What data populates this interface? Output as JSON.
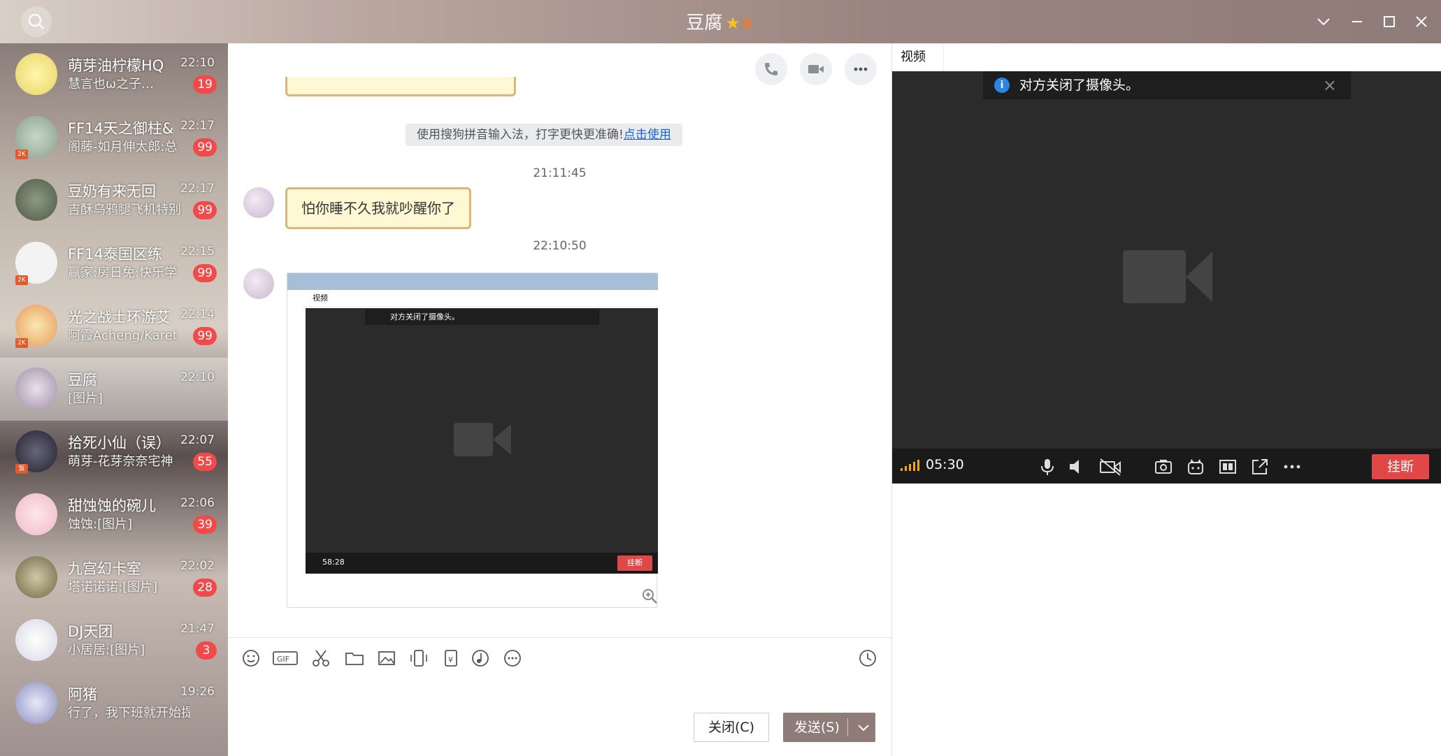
{
  "window": {
    "title": "豆腐"
  },
  "conversations": [
    {
      "name": "萌芽油柠檬HQ",
      "time": "22:10",
      "preview": "慧言也ω之子…",
      "badge": "19",
      "tag": ""
    },
    {
      "name": "FF14天之御柱&",
      "time": "22:17",
      "preview": "阁藤-如月伸太郎:总",
      "badge": "99",
      "tag": "2K"
    },
    {
      "name": "豆奶有来无回",
      "time": "22:17",
      "preview": "吉酥乌鸦腿飞机特别",
      "badge": "99",
      "tag": ""
    },
    {
      "name": "FF14泰国区练",
      "time": "22:15",
      "preview": "赢家:房日免:快乐学",
      "badge": "99",
      "tag": "2K"
    },
    {
      "name": "光之战士环游艾",
      "time": "22:14",
      "preview": "阿霞Acheng/Karet",
      "badge": "99",
      "tag": "2K"
    },
    {
      "name": "豆腐",
      "time": "22:10",
      "preview": "[图片]",
      "badge": "",
      "tag": ""
    },
    {
      "name": "拾死小仙（误）",
      "time": "22:07",
      "preview": "萌芽-花芽奈奈宅神",
      "badge": "55",
      "tag": "饭"
    },
    {
      "name": "甜蚀蚀的碗儿",
      "time": "22:06",
      "preview": "蚀蚀:[图片]",
      "badge": "39",
      "tag": ""
    },
    {
      "name": "九宫幻卡室",
      "time": "22:02",
      "preview": "塔诺诺诺:[图片]",
      "badge": "28",
      "tag": ""
    },
    {
      "name": "DJ天团",
      "time": "21:47",
      "preview": "小居居:[图片]",
      "badge": "3",
      "tag": ""
    },
    {
      "name": "阿猪",
      "time": "19:26",
      "preview": "行了，我下班就开始提醒",
      "badge": "",
      "tag": ""
    }
  ],
  "chat": {
    "hint_text": "使用搜狗拼音输入法，打字更快更准确!",
    "hint_link": "点击使用",
    "timestamp1": "21:11:45",
    "message1": "怕你睡不久我就吵醒你了",
    "timestamp2": "22:10:50",
    "embed": {
      "tab": "视频",
      "notice": "对方关闭了摄像头。",
      "time": "58:28",
      "hangup": "挂断"
    },
    "close_label": "关闭(C)",
    "send_label": "发送(S)"
  },
  "video": {
    "tab": "视频",
    "notice": "对方关闭了摄像头。",
    "call_time": "05:30",
    "hangup_label": "挂断"
  },
  "colors": {
    "titlebar": "#9b8580",
    "badge": "#f24a4a",
    "hangup": "#e04848",
    "accent_link": "#1a64d8"
  }
}
